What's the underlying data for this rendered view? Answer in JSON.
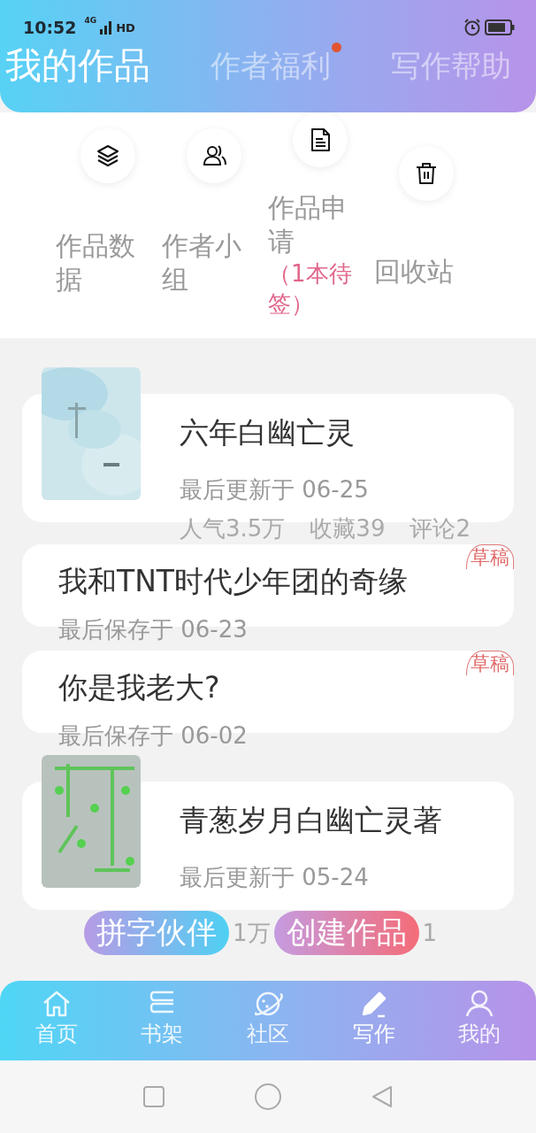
{
  "status_bar": {
    "time": "10:52",
    "network": "4G",
    "hd": "HD"
  },
  "tabs": [
    {
      "label": "我的作品",
      "selected": true,
      "dot": false
    },
    {
      "label": "作者福利",
      "selected": false,
      "dot": true
    },
    {
      "label": "写作帮助",
      "selected": false,
      "dot": false
    }
  ],
  "actions": [
    {
      "label": "作品数据"
    },
    {
      "label": "作者小组"
    },
    {
      "label": "作品申请",
      "note": "（1本待签）"
    },
    {
      "label": "回收站"
    }
  ],
  "works": [
    {
      "kind": "published",
      "title": "六年白幽亡灵",
      "meta": "最后更新于 06-25",
      "stats": [
        "人气3.5万",
        "收藏39",
        "评论2"
      ]
    },
    {
      "kind": "draft",
      "title": "我和TNT时代少年团的奇缘",
      "meta": "最后保存于 06-23",
      "badge": "草稿"
    },
    {
      "kind": "draft",
      "title": "你是我老大?",
      "meta": "最后保存于 06-02",
      "badge": "草稿"
    },
    {
      "kind": "published",
      "title": "青葱岁月白幽亡灵著",
      "meta": "最后更新于 05-24"
    }
  ],
  "float_row": [
    {
      "kind": "button",
      "label": "拼字伙伴"
    },
    {
      "kind": "text",
      "label": "1万"
    },
    {
      "kind": "button",
      "label": "创建作品"
    },
    {
      "kind": "text",
      "label": "1"
    }
  ],
  "bottom_nav": [
    {
      "label": "首页",
      "selected": false
    },
    {
      "label": "书架",
      "selected": false
    },
    {
      "label": "社区",
      "selected": false
    },
    {
      "label": "写作",
      "selected": true
    },
    {
      "label": "我的",
      "selected": false
    }
  ]
}
